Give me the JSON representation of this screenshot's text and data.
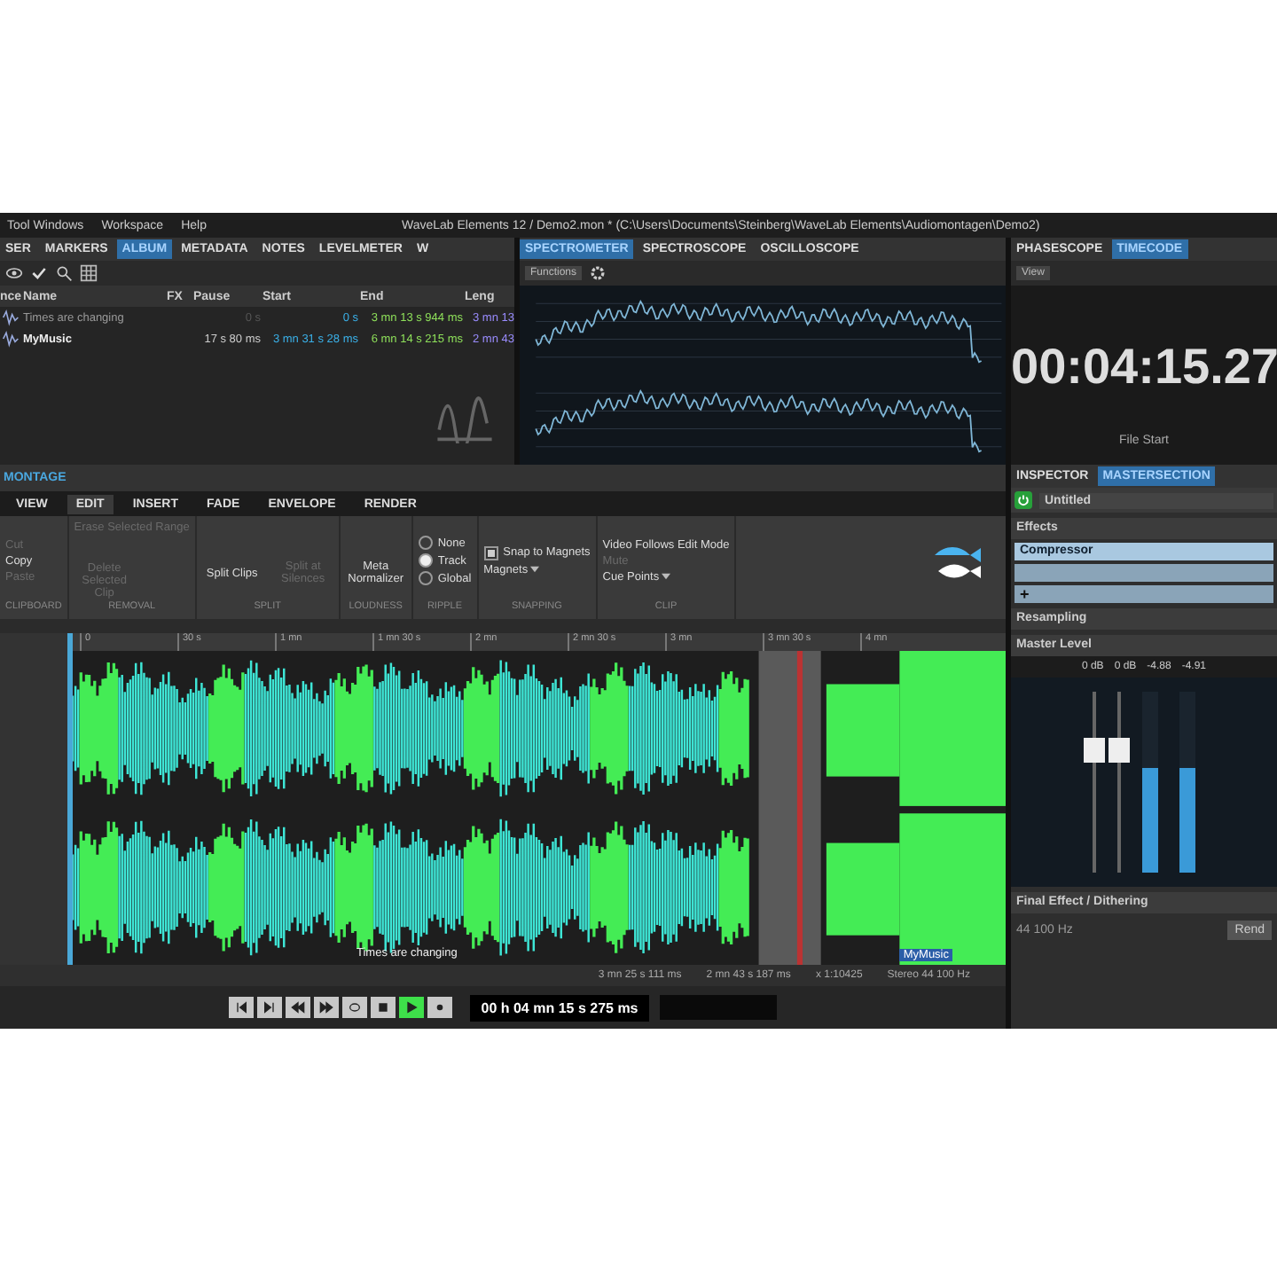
{
  "menu": [
    "Tool Windows",
    "Workspace",
    "Help"
  ],
  "window": {
    "title": "WaveLab Elements 12 / Demo2.mon * (C:\\Users\\Documents\\Steinberg\\WaveLab Elements\\Audiomontagen\\Demo2)"
  },
  "album_panel": {
    "tabs": [
      {
        "label": "SER",
        "selected": false
      },
      {
        "label": "MARKERS",
        "selected": false
      },
      {
        "label": "ALBUM",
        "selected": true
      },
      {
        "label": "METADATA",
        "selected": false
      },
      {
        "label": "NOTES",
        "selected": false
      },
      {
        "label": "LEVELMETER",
        "selected": false
      },
      {
        "label": "W",
        "selected": false
      }
    ],
    "columns": [
      "nce",
      "Name",
      "FX",
      "Pause",
      "Start",
      "End",
      "Leng"
    ],
    "rows": [
      {
        "name": "Times are changing",
        "pause": "0 s",
        "start": "0 s",
        "end": "3 mn 13 s 944 ms",
        "length": "3 mn 13",
        "muted": true
      },
      {
        "name": "MyMusic",
        "pause": "17 s 80 ms",
        "start": "3 mn 31 s 28 ms",
        "end": "6 mn 14 s 215 ms",
        "length": "2 mn 43",
        "muted": false
      }
    ]
  },
  "spectrum_panel": {
    "tabs": [
      {
        "label": "SPECTROMETER",
        "selected": true
      },
      {
        "label": "SPECTROSCOPE",
        "selected": false
      },
      {
        "label": "OSCILLOSCOPE",
        "selected": false
      }
    ],
    "functions_button": "Functions"
  },
  "timecode_panel": {
    "tabs": [
      {
        "label": "PHASESCOPE",
        "selected": false
      },
      {
        "label": "TIMECODE",
        "selected": true
      }
    ],
    "view_button": "View",
    "time": "00:04:15.27",
    "file_start": "File Start"
  },
  "montage": {
    "title": "MONTAGE",
    "tabs": [
      {
        "label": "VIEW",
        "selected": false
      },
      {
        "label": "EDIT",
        "selected": true
      },
      {
        "label": "INSERT",
        "selected": false
      },
      {
        "label": "FADE",
        "selected": false
      },
      {
        "label": "ENVELOPE",
        "selected": false
      },
      {
        "label": "RENDER",
        "selected": false
      }
    ],
    "groups": [
      {
        "label": "CLIPBOARD",
        "items": [
          {
            "kind": "small",
            "label": "Cut",
            "disabled": true
          },
          {
            "kind": "small",
            "label": "Copy",
            "disabled": false
          },
          {
            "kind": "small",
            "label": "Paste",
            "disabled": true
          }
        ]
      },
      {
        "label": "REMOVAL",
        "items": [
          {
            "kind": "small",
            "label": "Erase Selected Range",
            "disabled": true
          },
          {
            "kind": "large",
            "label": "Delete Selected Clip",
            "disabled": true
          }
        ]
      },
      {
        "label": "SPLIT",
        "items": [
          {
            "kind": "large",
            "label": "Split Clips",
            "disabled": false
          },
          {
            "kind": "large",
            "label": "Split at Silences",
            "disabled": true
          }
        ]
      },
      {
        "label": "LOUDNESS",
        "items": [
          {
            "kind": "large",
            "label": "Meta Normalizer",
            "disabled": false
          }
        ]
      },
      {
        "label": "RIPPLE",
        "items": [
          {
            "kind": "radio",
            "label": "None",
            "selected": false
          },
          {
            "kind": "radio",
            "label": "Track",
            "selected": true
          },
          {
            "kind": "radio",
            "label": "Global",
            "selected": false
          }
        ]
      },
      {
        "label": "SNAPPING",
        "items": [
          {
            "kind": "checkbox",
            "label": "Snap to Magnets",
            "checked": true
          },
          {
            "kind": "dropdown",
            "label": "Magnets",
            "disabled": false
          }
        ]
      },
      {
        "label": "CLIP",
        "items": [
          {
            "kind": "small",
            "label": "Video Follows Edit Mode",
            "disabled": false
          },
          {
            "kind": "small",
            "label": "Mute",
            "disabled": true
          },
          {
            "kind": "dropdown",
            "label": "Cue Points",
            "disabled": false
          }
        ]
      }
    ]
  },
  "track": {
    "ruler": [
      "0",
      "30 s",
      "1 mn",
      "1 mn 30 s",
      "2 mn",
      "2 mn 30 s",
      "3 mn",
      "3 mn 30 s",
      "4 mn"
    ],
    "clips": [
      {
        "label": "Times are changing"
      },
      {
        "label": "MyMusic"
      }
    ]
  },
  "status": [
    "3 mn 25 s 111 ms",
    "2 mn 43 s 187 ms",
    "x 1:10425",
    "Stereo 44 100 Hz"
  ],
  "transport": {
    "buttons": [
      {
        "kind": "to-start",
        "active": false
      },
      {
        "kind": "to-end",
        "active": false
      },
      {
        "kind": "rewind",
        "active": false
      },
      {
        "kind": "forward",
        "active": false
      },
      {
        "kind": "loop",
        "active": false
      },
      {
        "kind": "stop",
        "active": false
      },
      {
        "kind": "play",
        "active": true
      },
      {
        "kind": "record",
        "active": false
      }
    ],
    "time": "00 h 04 mn 15 s 275 ms"
  },
  "master": {
    "tabs": [
      {
        "label": "INSPECTOR",
        "selected": false
      },
      {
        "label": "MASTERSECTION",
        "selected": true
      }
    ],
    "preset": "Untitled",
    "power_on": true,
    "effects_title": "Effects",
    "effects": [
      {
        "label": "Compressor"
      }
    ],
    "add": "+",
    "resampling": "Resampling",
    "level_title": "Master Level",
    "readings": [
      "0 dB",
      "0 dB",
      "-4.88",
      "-4.91"
    ],
    "faders": [
      {
        "level": 0.75
      },
      {
        "level": 0.75
      }
    ],
    "meters": [
      {
        "level": 0.58
      },
      {
        "level": 0.58
      }
    ],
    "final_title": "Final Effect / Dithering",
    "rate": "44 100 Hz",
    "render_button": "Rend"
  }
}
